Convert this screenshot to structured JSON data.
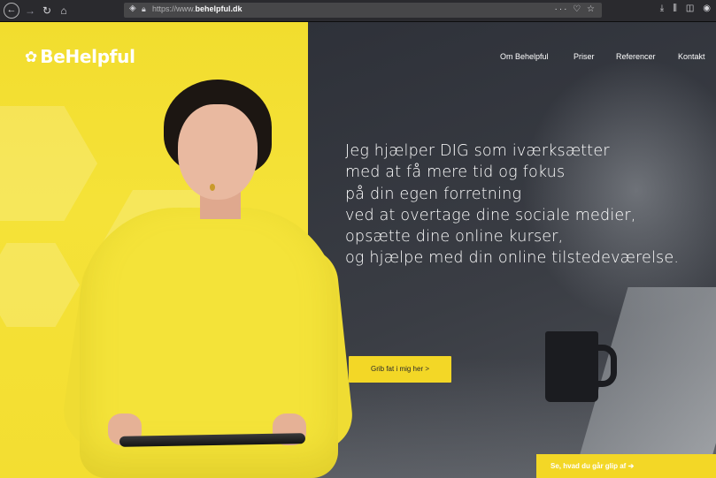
{
  "browser": {
    "back_icon": "arrow-left-icon",
    "forward_icon": "arrow-right-icon",
    "reload_icon": "reload-icon",
    "home_icon": "home-icon",
    "url_prefix": "https://www.",
    "url_domain": "behelpful.dk",
    "page_actions": "··· ♡ ☆",
    "toolbar_icons": [
      "download-icon",
      "library-icon",
      "sidebar-icon",
      "account-icon"
    ]
  },
  "site": {
    "logo_text": "BeHelpful",
    "logo_icon": "bee-icon",
    "nav": [
      "Om Behelpful",
      "Priser",
      "Referencer",
      "Kontakt"
    ],
    "hero_lines": [
      "Jeg hjælper DIG som iværksætter",
      "med at få mere tid og fokus",
      "på din egen forretning",
      "ved at overtage dine sociale medier,",
      "opsætte dine online kurser,",
      "og hjælpe med din online tilstedeværelse."
    ],
    "cta_label": "Grib fat i mig her >",
    "banner_label": "Se, hvad du går glip af  ➔"
  },
  "colors": {
    "accent_yellow": "#f3d726",
    "dark_panel": "#2e3139",
    "text_white": "#ffffff"
  }
}
